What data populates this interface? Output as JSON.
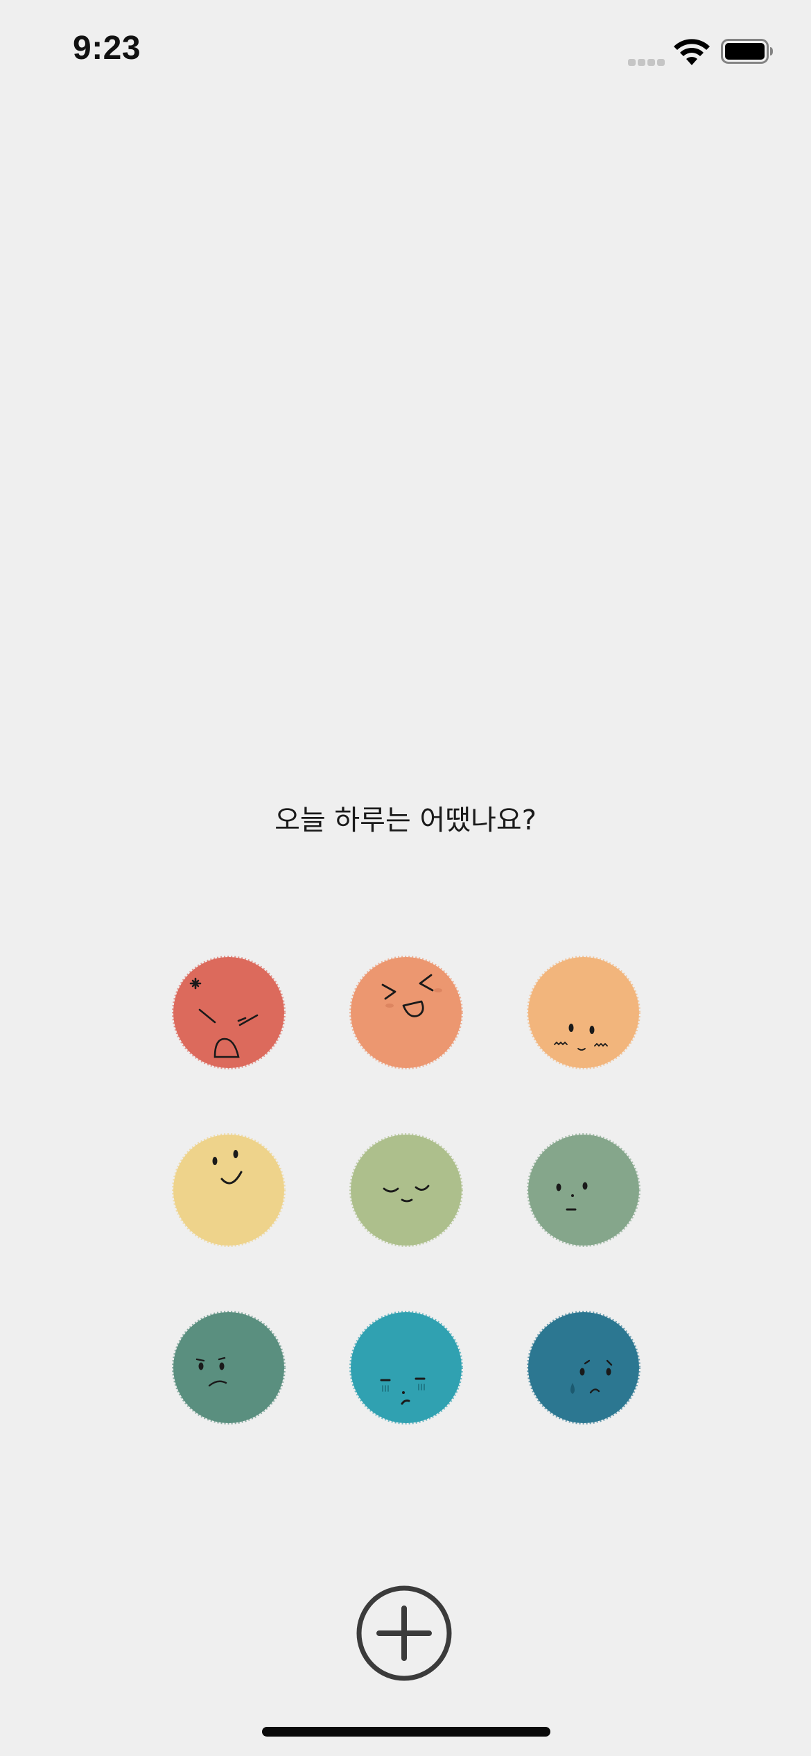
{
  "status_bar": {
    "time": "9:23"
  },
  "question": "오늘 하루는 어땠나요?",
  "moods": [
    {
      "name": "angry",
      "color": "#dc6a5c"
    },
    {
      "name": "laughing",
      "color": "#ec9770"
    },
    {
      "name": "flustered",
      "color": "#f2b57c"
    },
    {
      "name": "happy",
      "color": "#eed38b"
    },
    {
      "name": "calm",
      "color": "#adbf8c"
    },
    {
      "name": "neutral",
      "color": "#85a68b"
    },
    {
      "name": "displeased",
      "color": "#5a8f7f"
    },
    {
      "name": "gloomy",
      "color": "#30a1b1"
    },
    {
      "name": "sad",
      "color": "#2c7791"
    }
  ],
  "add_button": {
    "icon": "plus-circle-icon"
  },
  "colors": {
    "background": "#efefef",
    "text": "#1a1a1a",
    "add_button_stroke": "#3b3b3b"
  }
}
